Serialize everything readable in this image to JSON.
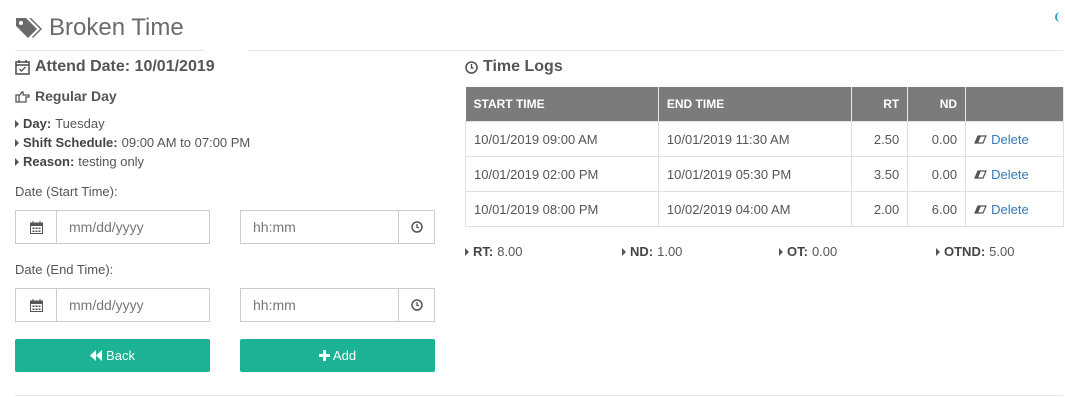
{
  "header": {
    "title": "Broken Time",
    "icon": "tags-icon"
  },
  "attend": {
    "label": "Attend Date: 10/01/2019",
    "icon": "calendar-check-icon"
  },
  "day_type": {
    "label": "Regular Day",
    "icon": "hand-right-icon"
  },
  "details": [
    {
      "key": "Day:",
      "value": "Tuesday"
    },
    {
      "key": "Shift Schedule:",
      "value": "09:00 AM to 07:00 PM"
    },
    {
      "key": "Reason:",
      "value": "testing only"
    }
  ],
  "form": {
    "start_label": "Date (Start Time):",
    "end_label": "Date (End Time):",
    "date_placeholder": "mm/dd/yyyy",
    "time_placeholder": "hh:mm",
    "back_label": "Back",
    "add_label": "Add"
  },
  "time_logs": {
    "title": "Time Logs",
    "columns": [
      "START TIME",
      "END TIME",
      "RT",
      "ND",
      ""
    ],
    "rows": [
      {
        "start": "10/01/2019 09:00 AM",
        "end": "10/01/2019 11:30 AM",
        "rt": "2.50",
        "nd": "0.00",
        "action": "Delete"
      },
      {
        "start": "10/01/2019 02:00 PM",
        "end": "10/01/2019 05:30 PM",
        "rt": "3.50",
        "nd": "0.00",
        "action": "Delete"
      },
      {
        "start": "10/01/2019 08:00 PM",
        "end": "10/02/2019 04:00 AM",
        "rt": "2.00",
        "nd": "6.00",
        "action": "Delete"
      }
    ]
  },
  "totals": [
    {
      "key": "RT:",
      "value": "8.00"
    },
    {
      "key": "ND:",
      "value": "1.00"
    },
    {
      "key": "OT:",
      "value": "0.00"
    },
    {
      "key": "OTND:",
      "value": "5.00"
    }
  ],
  "colors": {
    "accent": "#1bb394",
    "header_bg": "#7b7b7b",
    "link": "#337ab7"
  }
}
